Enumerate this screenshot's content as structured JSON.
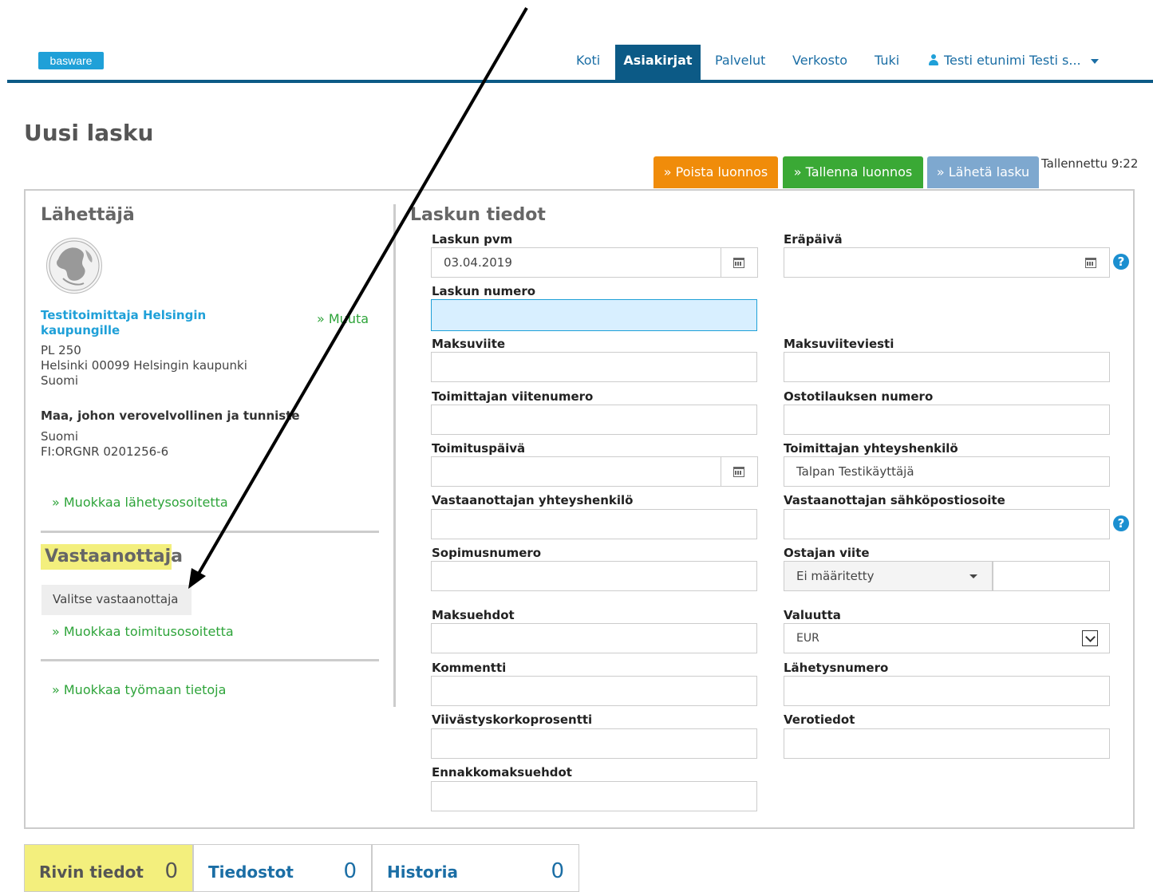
{
  "brand": {
    "logo": "basware"
  },
  "nav": {
    "items": [
      {
        "label": "Koti"
      },
      {
        "label": "Asiakirjat",
        "active": true
      },
      {
        "label": "Palvelut"
      },
      {
        "label": "Verkosto"
      },
      {
        "label": "Tuki"
      }
    ],
    "user": "Testi etunimi Testi s..."
  },
  "page": {
    "title": "Uusi lasku"
  },
  "actions": {
    "delete_draft": "» Poista luonnos",
    "save_draft": "» Tallenna luonnos",
    "send_invoice": "» Lähetä lasku",
    "saved_status": "Tallennettu 9:22"
  },
  "sender": {
    "heading": "Lähettäjä",
    "name": "Testitoimittaja Helsingin kaupungille",
    "change_link": "» Muuta",
    "address_lines": [
      "PL 250",
      "Helsinki 00099 Helsingin kaupunki",
      "Suomi"
    ],
    "tax_label": "Maa, johon verovelvollinen ja tunniste",
    "tax_country": "Suomi",
    "tax_id": "FI:ORGNR 0201256-6",
    "edit_sending_address": "» Muokkaa lähetysosoitetta"
  },
  "recipient": {
    "heading": "Vastaanottaja",
    "choose_button": "Valitse vastaanottaja",
    "edit_delivery_address": "» Muokkaa toimitusosoitetta",
    "edit_site_info": "» Muokkaa työmaan tietoja"
  },
  "invoice": {
    "heading": "Laskun tiedot",
    "fields": {
      "invoice_date": {
        "label": "Laskun pvm",
        "value": "03.04.2019"
      },
      "due_date": {
        "label": "Eräpäivä",
        "value": ""
      },
      "invoice_number": {
        "label": "Laskun numero",
        "value": ""
      },
      "payment_reference": {
        "label": "Maksuviite",
        "value": ""
      },
      "payment_message": {
        "label": "Maksuviiteviesti",
        "value": ""
      },
      "supplier_reference": {
        "label": "Toimittajan viitenumero",
        "value": ""
      },
      "purchase_order": {
        "label": "Ostotilauksen numero",
        "value": ""
      },
      "delivery_date": {
        "label": "Toimituspäivä",
        "value": ""
      },
      "supplier_contact": {
        "label": "Toimittajan yhteyshenkilö",
        "value": "Talpan Testikäyttäjä"
      },
      "recipient_contact": {
        "label": "Vastaanottajan yhteyshenkilö",
        "value": ""
      },
      "recipient_email": {
        "label": "Vastaanottajan sähköpostiosoite",
        "value": ""
      },
      "contract_number": {
        "label": "Sopimusnumero",
        "value": ""
      },
      "buyer_reference": {
        "label": "Ostajan viite",
        "select_value": "Ei määritetty",
        "value": ""
      },
      "payment_terms": {
        "label": "Maksuehdot",
        "value": ""
      },
      "currency": {
        "label": "Valuutta",
        "value": "EUR"
      },
      "comment": {
        "label": "Kommentti",
        "value": ""
      },
      "shipment_number": {
        "label": "Lähetysnumero",
        "value": ""
      },
      "late_interest": {
        "label": "Viivästyskorkoprosentti",
        "value": ""
      },
      "tax_info": {
        "label": "Verotiedot",
        "value": ""
      },
      "advance_terms": {
        "label": "Ennakkomaksuehdot",
        "value": ""
      }
    }
  },
  "bottom_tabs": [
    {
      "label": "Rivin tiedot",
      "count": "0",
      "active": true
    },
    {
      "label": "Tiedostot",
      "count": "0"
    },
    {
      "label": "Historia",
      "count": "0"
    }
  ],
  "icons": {
    "help": "?",
    "calendar": "calendar-icon",
    "user": "user-icon"
  }
}
